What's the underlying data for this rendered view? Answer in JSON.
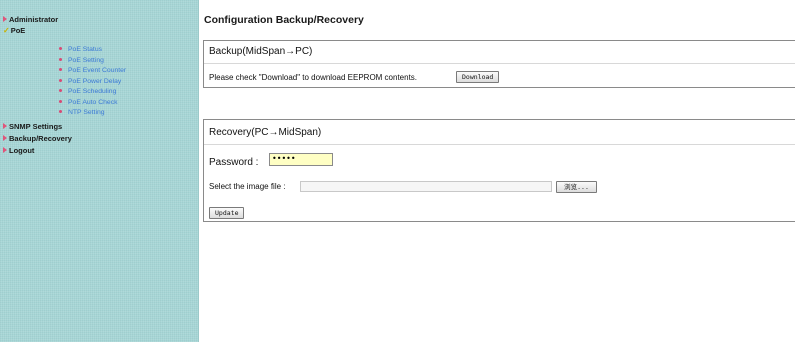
{
  "sidebar": {
    "top_items": [
      {
        "label": "Administrator"
      },
      {
        "label": "PoE"
      },
      {
        "label": "SNMP Settings"
      },
      {
        "label": "Backup/Recovery"
      },
      {
        "label": "Logout"
      }
    ],
    "poe_sub_items": [
      {
        "label": "PoE Status"
      },
      {
        "label": "PoE Setting"
      },
      {
        "label": "PoE Event Counter"
      },
      {
        "label": "PoE Power Delay"
      },
      {
        "label": "PoE Scheduling"
      },
      {
        "label": "PoE Auto Check"
      },
      {
        "label": "NTP Setting"
      }
    ],
    "colors": {
      "background": "#a6d6d6",
      "sub_link": "#3c7ad6",
      "bullet": "#d84a75",
      "arrow": "#e0557a"
    }
  },
  "page": {
    "title": "Configuration Backup/Recovery"
  },
  "backup": {
    "title": "Backup(MidSpan→PC)",
    "instruction": "Please check \"Download\" to download EEPROM contents.",
    "download_label": "Download"
  },
  "recovery": {
    "title": "Recovery(PC→MidSpan)",
    "password_label": "Password :",
    "password_value": "•••••",
    "file_label": "Select the image file :",
    "browse_label": "浏览...",
    "update_label": "Update"
  }
}
